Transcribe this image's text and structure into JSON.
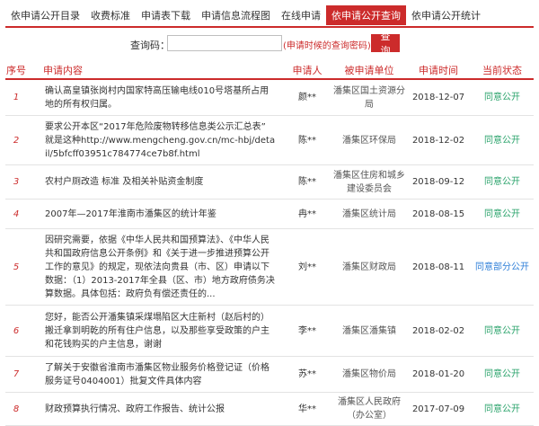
{
  "tabs": [
    {
      "label": "依申请公开目录",
      "active": false
    },
    {
      "label": "收费标准",
      "active": false
    },
    {
      "label": "申请表下载",
      "active": false
    },
    {
      "label": "申请信息流程图",
      "active": false
    },
    {
      "label": "在线申请",
      "active": false
    },
    {
      "label": "依申请公开查询",
      "active": true
    },
    {
      "label": "依申请公开统计",
      "active": false
    }
  ],
  "query": {
    "label": "查询码：",
    "value": "",
    "placeholder": "",
    "hint": "(申请时候的查询密码)",
    "button": "查询"
  },
  "table": {
    "headers": {
      "no": "序号",
      "content": "申请内容",
      "applicant": "申请人",
      "unit": "被申请单位",
      "time": "申请时间",
      "status": "当前状态"
    },
    "rows": [
      {
        "no": "1",
        "content": "确认高皇镇张岗村内国家特高压输电线010号塔基所占用地的所有权归属。",
        "applicant": "颜**",
        "unit": "潘集区国土资源分局",
        "time": "2018-12-07",
        "status": "同意公开"
      },
      {
        "no": "2",
        "content": "要求公开本区“2017年危险废物转移信息类公示汇总表” 就是这种http://www.mengcheng.gov.cn/mc-hbj/detail/5bfcff03951c784774ce7b8f.html",
        "applicant": "陈**",
        "unit": "潘集区环保局",
        "time": "2018-12-02",
        "status": "同意公开"
      },
      {
        "no": "3",
        "content": "农村户厕改造 标准 及相关补贴资金制度",
        "applicant": "陈**",
        "unit": "潘集区住房和城乡建设委员会",
        "time": "2018-09-12",
        "status": "同意公开"
      },
      {
        "no": "4",
        "content": "2007年—2017年淮南市潘集区的统计年鉴",
        "applicant": "冉**",
        "unit": "潘集区统计局",
        "time": "2018-08-15",
        "status": "同意公开"
      },
      {
        "no": "5",
        "content": "因研究需要，依据《中华人民共和国预算法》、《中华人民共和国政府信息公开条例》和《关于进一步推进预算公开工作的意见》的规定，现依法向贵县（市、区）申请以下数据：（1）2013-2017年全县（区、市）地方政府债务决算数据。具体包括：政府负有偿还责任的...",
        "applicant": "刘**",
        "unit": "潘集区财政局",
        "time": "2018-08-11",
        "status": "同意部分公开"
      },
      {
        "no": "6",
        "content": "您好，能否公开潘集镇采煤塌陷区大庄新村（赵后村的）搬迁拿到明乾的所有住户信息，以及那些享受政策的户主和花钱购买的户主信息，谢谢",
        "applicant": "李**",
        "unit": "潘集区潘集镇",
        "time": "2018-02-02",
        "status": "同意公开"
      },
      {
        "no": "7",
        "content": "了解关于安徽省淮南市潘集区物业服务价格登记证（价格服务证号0404001）批复文件具体内容",
        "applicant": "苏**",
        "unit": "潘集区物价局",
        "time": "2018-01-20",
        "status": "同意公开"
      },
      {
        "no": "8",
        "content": "财政预算执行情况、政府工作报告、统计公报",
        "applicant": "华**",
        "unit": "潘集区人民政府（办公室）",
        "time": "2017-07-09",
        "status": "同意公开"
      }
    ]
  },
  "colors": {
    "accent": "#cc2b2b",
    "status_green": "#2aa36b",
    "status_blue": "#2f7fd8"
  }
}
